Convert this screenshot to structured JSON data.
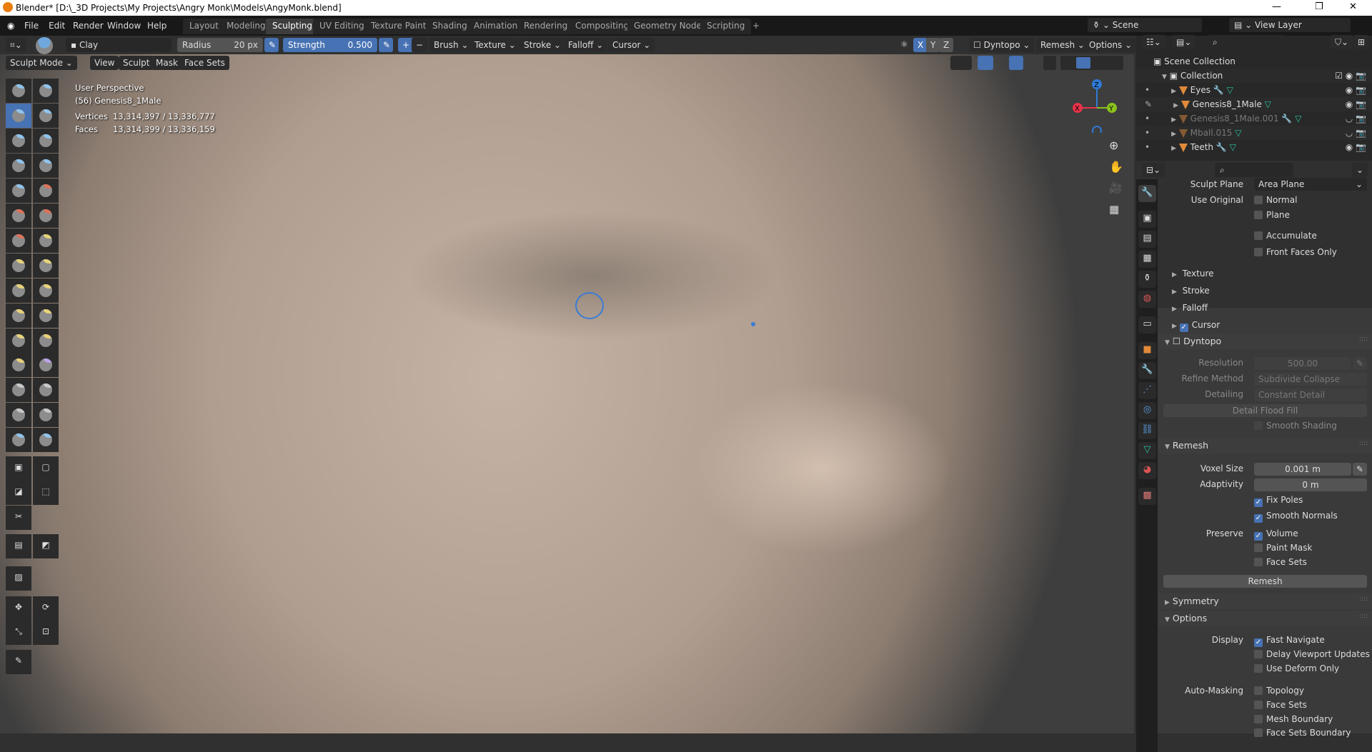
{
  "window": {
    "title": "Blender* [D:\\_3D Projects\\My Projects\\Angry Monk\\Models\\AngyMonk.blend]",
    "minimize": "—",
    "maximize": "❐",
    "close": "✕"
  },
  "menu": [
    "File",
    "Edit",
    "Render",
    "Window",
    "Help"
  ],
  "workspaces": [
    {
      "label": "Layout"
    },
    {
      "label": "Modeling"
    },
    {
      "label": "Sculpting",
      "active": true
    },
    {
      "label": "UV Editing"
    },
    {
      "label": "Texture Paint"
    },
    {
      "label": "Shading"
    },
    {
      "label": "Animation"
    },
    {
      "label": "Rendering"
    },
    {
      "label": "Compositing"
    },
    {
      "label": "Geometry Nodes"
    },
    {
      "label": "Scripting"
    },
    {
      "label": "+"
    }
  ],
  "scene": {
    "name": "Scene",
    "view_layer": "View Layer"
  },
  "header": {
    "brush": "Clay",
    "radius_label": "Radius",
    "radius_value": "20 px",
    "strength_label": "Strength",
    "strength_value": "0.500",
    "plus": "+",
    "minus": "−",
    "menus": [
      "Brush ⌄",
      "Texture ⌄",
      "Stroke ⌄",
      "Falloff ⌄",
      "Cursor ⌄"
    ],
    "axes": [
      "X",
      "Y",
      "Z"
    ],
    "dyntopo": "Dyntopo ⌄",
    "remesh": "Remesh ⌄",
    "options": "Options ⌄"
  },
  "mode_bar": {
    "mode": "Sculpt Mode ⌄",
    "items": [
      "View",
      "Sculpt",
      "Mask",
      "Face Sets"
    ]
  },
  "overlay": {
    "view": "User Perspective",
    "object": "(56) Genesis8_1Male",
    "vertices_label": "Vertices",
    "vertices": "13,314,397 / 13,336,777",
    "faces_label": "Faces",
    "faces": "13,314,399 / 13,336,159"
  },
  "gizmo": {
    "x": "X",
    "y": "Y",
    "z": "Z",
    "colors": {
      "x": "#e8334a",
      "y": "#8bc21c",
      "z": "#2f7ad6"
    }
  },
  "tool_colors": [
    "#8fc3ec",
    "#8fc3ec",
    "#8fc3ec",
    "#8fc3ec",
    "#8fc3ec",
    "#8fc3ec",
    "#8fc3ec",
    "#8fc3ec",
    "#8fc3ec",
    "#d9735a",
    "#d9735a",
    "#d9735a",
    "#d9735a",
    "#e6d27a",
    "#e6d27a",
    "#e6d27a",
    "#e6d27a",
    "#e6d27a",
    "#e6d27a",
    "#e6d27a",
    "#e6d27a",
    "#e6d27a",
    "#e6d27a",
    "#b7a3e8",
    "#c8c8c8",
    "#c8c8c8",
    "#c8c8c8",
    "#c8c8c8"
  ],
  "outliner": {
    "scene_collection": "Scene Collection",
    "collection": "Collection",
    "objects": [
      {
        "name": "Eyes",
        "visible": true,
        "modifier": true
      },
      {
        "name": "Genesis8_1Male",
        "visible": true,
        "active": true
      },
      {
        "name": "Genesis8_1Male.001",
        "visible": false,
        "modifier": true
      },
      {
        "name": "Mball.015",
        "visible": false
      },
      {
        "name": "Teeth",
        "visible": true,
        "modifier": true
      }
    ]
  },
  "properties": {
    "sculpt_plane_label": "Sculpt Plane",
    "sculpt_plane": "Area Plane",
    "use_original_label": "Use Original",
    "normal": "Normal",
    "plane": "Plane",
    "accumulate": "Accumulate",
    "front_faces_only": "Front Faces Only",
    "subpanels": [
      "Texture",
      "Stroke",
      "Falloff",
      "Cursor"
    ],
    "dyntopo": {
      "title": "Dyntopo",
      "resolution_label": "Resolution",
      "resolution": "500.00",
      "refine_label": "Refine Method",
      "refine": "Subdivide Collapse",
      "detailing_label": "Detailing",
      "detailing": "Constant Detail",
      "flood_fill": "Detail Flood Fill",
      "smooth_shading": "Smooth Shading"
    },
    "remesh": {
      "title": "Remesh",
      "voxel_label": "Voxel Size",
      "voxel": "0.001 m",
      "adaptivity_label": "Adaptivity",
      "adaptivity": "0 m",
      "fix_poles": "Fix Poles",
      "smooth_normals": "Smooth Normals",
      "preserve_label": "Preserve",
      "volume": "Volume",
      "paint_mask": "Paint Mask",
      "face_sets": "Face Sets",
      "button": "Remesh"
    },
    "symmetry": "Symmetry",
    "options": {
      "title": "Options",
      "display_label": "Display",
      "fast_navigate": "Fast Navigate",
      "delay_updates": "Delay Viewport Updates",
      "deform_only": "Use Deform Only",
      "automask_label": "Auto-Masking",
      "topology": "Topology",
      "face_sets": "Face Sets",
      "mesh_boundary": "Mesh Boundary",
      "face_sets_boundary": "Face Sets Boundary"
    }
  }
}
